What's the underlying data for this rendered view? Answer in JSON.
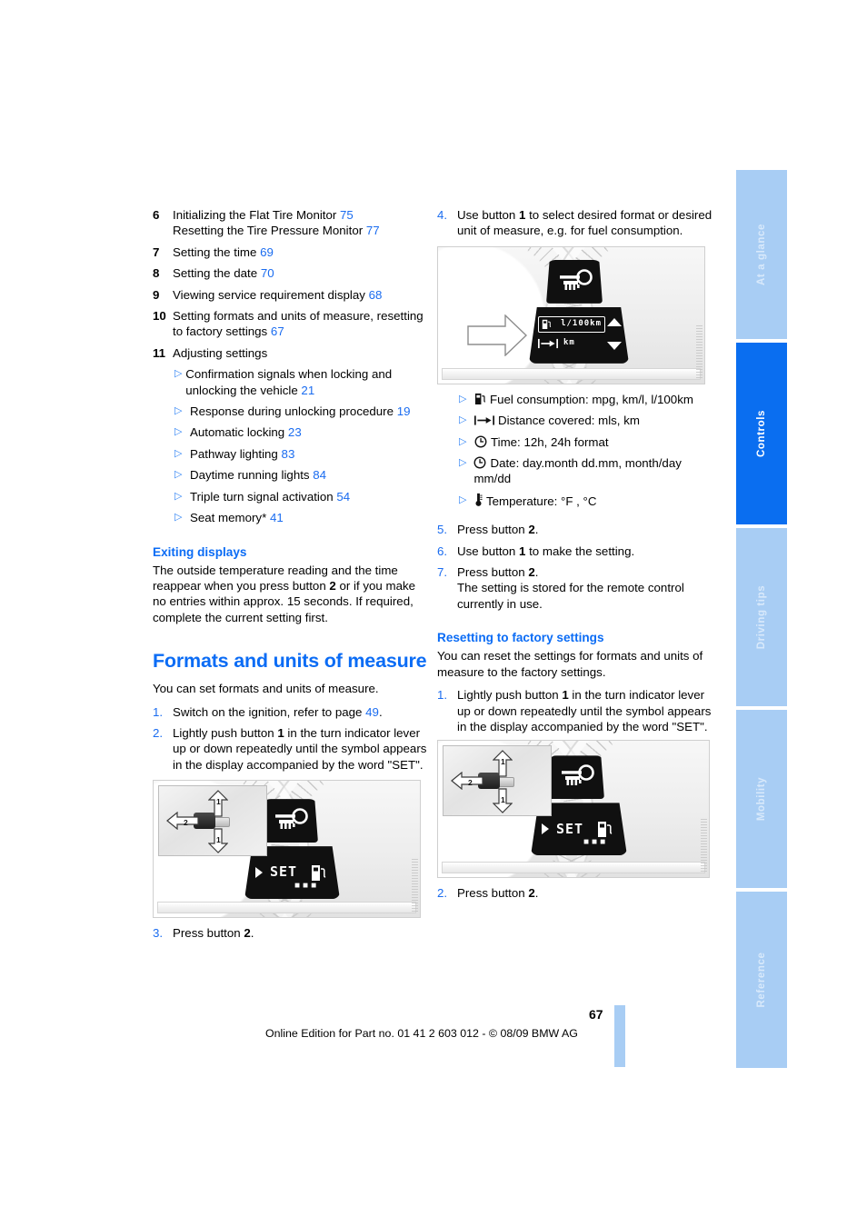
{
  "page": {
    "number": "67",
    "footer_text": "Online Edition for Part no. 01 41 2 603 012 - © 08/09 BMW AG"
  },
  "tabs": [
    {
      "label": "At a glance",
      "active": false
    },
    {
      "label": "Controls",
      "active": true
    },
    {
      "label": "Driving tips",
      "active": false
    },
    {
      "label": "Mobility",
      "active": false
    },
    {
      "label": "Reference",
      "active": false
    }
  ],
  "left_column": {
    "keyed_list": [
      {
        "key": "6",
        "lines": [
          {
            "text": "Initializing the Flat Tire Monitor",
            "page": "75"
          },
          {
            "text": "Resetting the Tire Pressure Monitor",
            "page": "77"
          }
        ]
      },
      {
        "key": "7",
        "lines": [
          {
            "text": "Setting the time",
            "page": "69"
          }
        ]
      },
      {
        "key": "8",
        "lines": [
          {
            "text": "Setting the date",
            "page": "70"
          }
        ]
      },
      {
        "key": "9",
        "lines": [
          {
            "text": "Viewing service requirement display",
            "page": "68"
          }
        ]
      },
      {
        "key": "10",
        "lines": [
          {
            "text": "Setting formats and units of measure, resetting to factory settings",
            "page": "67"
          }
        ]
      },
      {
        "key": "11",
        "lines": [
          {
            "text": "Adjusting settings",
            "page": ""
          }
        ]
      }
    ],
    "sub_bullets": [
      {
        "text": "Confirmation signals when locking and unlocking the vehicle",
        "page": "21"
      },
      {
        "text": "Response during unlocking procedure",
        "page": "19"
      },
      {
        "text": "Automatic locking",
        "page": "23"
      },
      {
        "text": "Pathway lighting",
        "page": "83"
      },
      {
        "text": "Daytime running lights",
        "page": "84"
      },
      {
        "text": "Triple turn signal activation",
        "page": "54"
      },
      {
        "text": "Seat memory*",
        "page": "41"
      }
    ],
    "exiting_displays": {
      "heading": "Exiting displays",
      "paragraph_1": "The outside temperature reading and the time reappear when you press button ",
      "bold_1": "2",
      "paragraph_2": " or if you make no entries within approx. 15 seconds. If required, complete the current setting first."
    },
    "formats_section": {
      "heading": "Formats and units of measure",
      "intro": "You can set formats and units of measure.",
      "steps": [
        {
          "num": "1.",
          "pre": "Switch on the ignition, refer to page ",
          "link": "49",
          "post": "."
        },
        {
          "num": "2.",
          "pre": "Lightly push button ",
          "bold": "1",
          "post": " in the turn indicator lever up or down repeatedly until the symbol appears in the display accompanied by the word \"SET\"."
        }
      ],
      "step_after_figure": {
        "num": "3.",
        "pre": "Press button ",
        "bold": "2",
        "post": "."
      }
    },
    "figure": {
      "set_text": "SET",
      "inset_label_up": "1",
      "inset_label_side": "2",
      "inset_label_down": "1"
    }
  },
  "right_column": {
    "step_4": {
      "num": "4.",
      "pre": "Use button ",
      "bold": "1",
      "post": " to select desired format or desired unit of measure, e.g. for fuel consumption."
    },
    "figure_display": {
      "row_1_value": "l/100km",
      "row_2_value": "km"
    },
    "option_bullets": [
      {
        "icon": "fuel-pump-icon",
        "text": "Fuel consumption: mpg, km/l, l/100km"
      },
      {
        "icon": "distance-arrow-icon",
        "text": "Distance covered: mls, km"
      },
      {
        "icon": "clock-icon",
        "text": "Time: 12h, 24h format"
      },
      {
        "icon": "clock-icon",
        "text": "Date: day.month dd.mm, month/day mm/dd"
      },
      {
        "icon": "thermometer-icon",
        "text": "Temperature: °F , °C"
      }
    ],
    "steps": [
      {
        "num": "5.",
        "pre": "Press button ",
        "bold": "2",
        "post": "."
      },
      {
        "num": "6.",
        "pre": "Use button ",
        "bold": "1",
        "post": " to make the setting."
      },
      {
        "num": "7.",
        "pre": "Press button ",
        "bold": "2",
        "post": ".",
        "extra": "The setting is stored for the remote control currently in use."
      }
    ],
    "reset_section": {
      "heading": "Resetting to factory settings",
      "intro": "You can reset the settings for formats and units of measure to the factory settings.",
      "step_1": {
        "num": "1.",
        "pre": "Lightly push button ",
        "bold": "1",
        "post": " in the turn indicator lever up or down repeatedly until the symbol appears in the display accompanied by the word \"SET\"."
      },
      "step_2": {
        "num": "2.",
        "pre": "Press button ",
        "bold": "2",
        "post": "."
      }
    },
    "figure": {
      "set_text": "SET",
      "inset_label_up": "1",
      "inset_label_side": "2",
      "inset_label_down": "1"
    }
  },
  "colors": {
    "accent_blue": "#0b6cf5",
    "tab_light": "#a8cdf4",
    "tab_active": "#0a6ef0"
  }
}
